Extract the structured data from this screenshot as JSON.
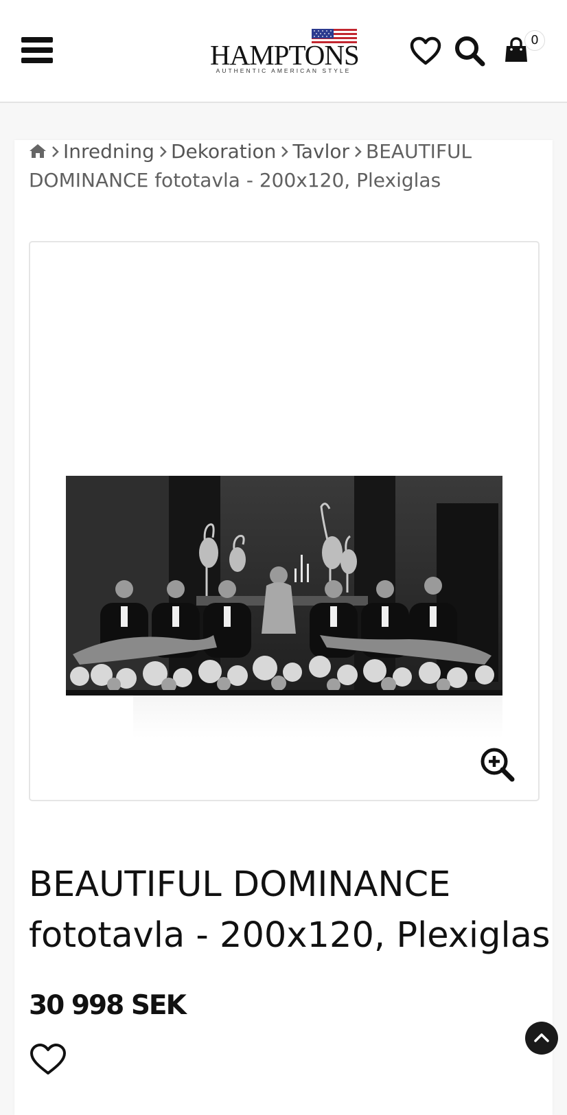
{
  "header": {
    "brand": "HAMPTONS",
    "tagline": "AUTHENTIC AMERICAN STYLE",
    "cart_count": "0",
    "icons": [
      "menu-icon",
      "heart-icon",
      "search-icon",
      "shopping-bag-icon"
    ]
  },
  "breadcrumb": {
    "items": [
      "Inredning",
      "Dekoration",
      "Tavlor"
    ],
    "current": "BEAUTIFUL DOMINANCE fototavla - 200x120, Plexiglas"
  },
  "product": {
    "title": "BEAUTIFUL DOMINANCE fototavla - 200x120, Plexiglas",
    "price": "30 998 SEK"
  },
  "colors": {
    "text": "#111111",
    "breadcrumb": "#606060",
    "border": "#e5e5e5",
    "flag_blue": "#2b3a8f",
    "flag_red": "#c2262f"
  }
}
